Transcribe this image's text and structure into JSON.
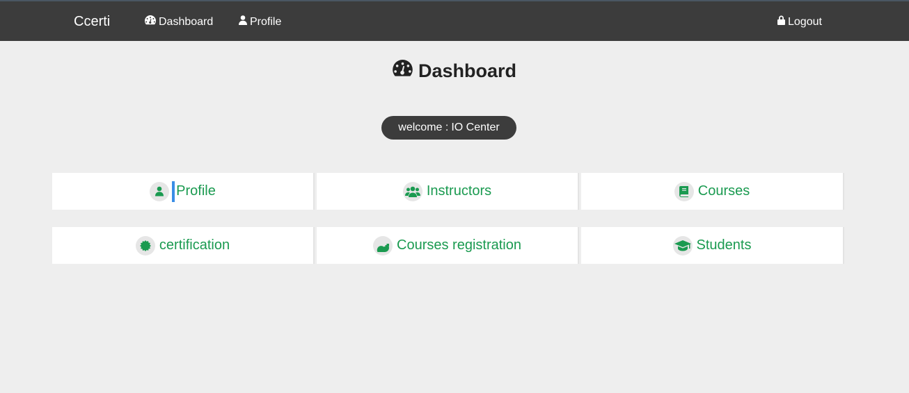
{
  "navbar": {
    "brand": "Ccerti",
    "links": [
      {
        "label": "Dashboard",
        "icon": "dashboard-icon"
      },
      {
        "label": "Profile",
        "icon": "user-icon"
      }
    ],
    "logout": {
      "label": "Logout",
      "icon": "lock-icon"
    }
  },
  "main": {
    "title": "Dashboard",
    "welcome": {
      "label": "welcome :",
      "name": "IO Center"
    },
    "tiles": [
      {
        "label": "Profile",
        "icon": "user-icon"
      },
      {
        "label": "Instructors",
        "icon": "users-icon"
      },
      {
        "label": "Courses",
        "icon": "book-icon"
      },
      {
        "label": "certification",
        "icon": "certificate-icon"
      },
      {
        "label": "Courses registration",
        "icon": "key-icon"
      },
      {
        "label": "Students",
        "icon": "graduation-cap-icon"
      }
    ]
  },
  "colors": {
    "navbar_bg": "#3c3c3c",
    "page_bg": "#eeeeee",
    "tile_text": "#1a9a50"
  }
}
